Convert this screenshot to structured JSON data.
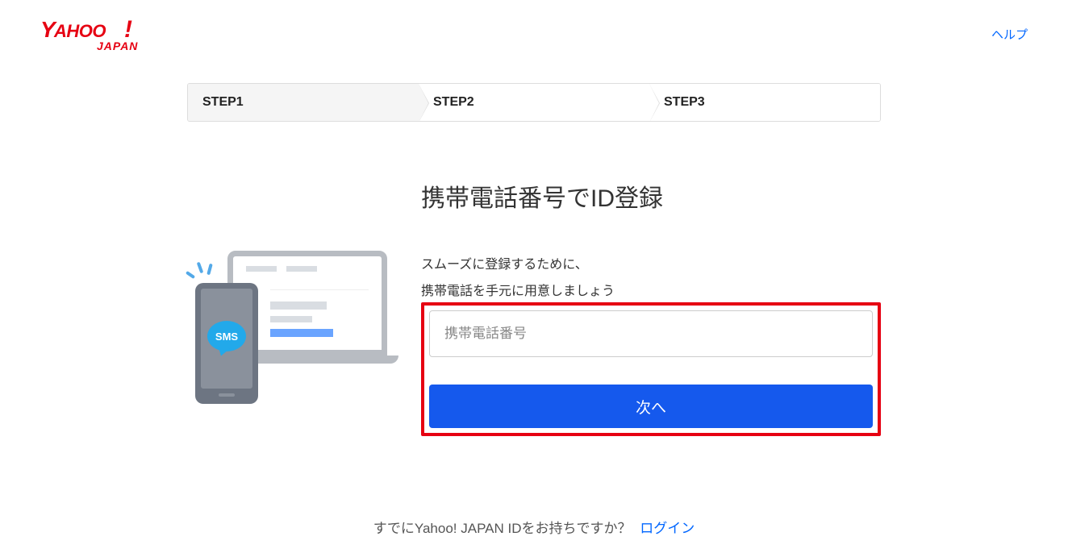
{
  "header": {
    "logo_main": "YAHOO!",
    "logo_sub": "JAPAN",
    "help_label": "ヘルプ"
  },
  "steps": {
    "step1": "STEP1",
    "step2": "STEP2",
    "step3": "STEP3"
  },
  "main": {
    "title": "携帯電話番号でID登録",
    "subtitle_line1": "スムーズに登録するために、",
    "subtitle_line2": "携帯電話を手元に用意しましょう",
    "phone_placeholder": "携帯電話番号",
    "next_label": "次へ"
  },
  "illustration": {
    "sms_badge": "SMS"
  },
  "footer": {
    "already_text": "すでにYahoo! JAPAN IDをお持ちですか？",
    "login_label": "ログイン"
  },
  "colors": {
    "accent_red": "#e60012",
    "accent_blue": "#1559ed",
    "link_blue": "#0066ff"
  }
}
